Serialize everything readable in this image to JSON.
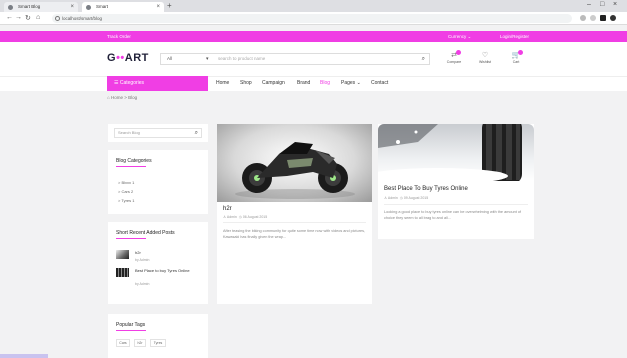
{
  "browser": {
    "tabs": [
      {
        "title": "Smart Blog"
      },
      {
        "title": "Smart"
      }
    ],
    "url": "localhost/smart/blog",
    "new_tab_glyph": "+",
    "close_glyph": "×",
    "window_controls": [
      "–",
      "□",
      "×"
    ]
  },
  "topbar": {
    "track": "Track Order",
    "currency": "Currency ⌄",
    "login": "Login/Register"
  },
  "header": {
    "logo_prefix": "G",
    "logo_mid": "••",
    "logo_suffix": "ART",
    "search_category": "All",
    "search_placeholder": "search to product name",
    "icons": [
      {
        "label": "Compare",
        "icon": "compare-icon",
        "glyph": "⇄"
      },
      {
        "label": "Wishlist",
        "icon": "heart-icon",
        "glyph": "♡"
      },
      {
        "label": "Cart",
        "icon": "cart-icon",
        "glyph": "🛒"
      }
    ]
  },
  "nav": {
    "categories": "☰  Categories",
    "items": [
      "Home",
      "Shop",
      "Campaign",
      "Brand",
      "Blog",
      "Pages ⌄",
      "Contact"
    ],
    "active": "Blog"
  },
  "breadcrumb": "⌂ Home  >  Blog",
  "sidebar": {
    "search_placeholder": "Search Blog",
    "categories_title": "Blog Categories",
    "categories": [
      "> Blxxx 1",
      "> Cars 2",
      "> Tyres 1"
    ],
    "recent_title": "Short Recent Added Posts",
    "recent": [
      {
        "title": "h2r",
        "by": "by Admin"
      },
      {
        "title": "Best Place to buy Tyres Online",
        "by": "by Admin"
      }
    ],
    "tags_title": "Popular Tags",
    "tags": [
      "Cars",
      "h2r",
      "Tyres"
    ]
  },
  "posts": [
    {
      "title": "h2r",
      "author": "Admin",
      "date": "06 August 2015",
      "excerpt": "After teasing the biking community for quite some time now with videos and pictures, Kawasaki has finally given the wrap..."
    },
    {
      "title": "Best Place To Buy Tyres Online",
      "author": "Admin",
      "date": "09 August 2015",
      "excerpt": "Looking a good place to buy tyres online can be overwhelming with the amount of choice they seem to all brag to and all..."
    }
  ],
  "colors": {
    "accent": "#f03ee4",
    "dark": "#22223a",
    "page_bg": "#f2f2f3"
  }
}
